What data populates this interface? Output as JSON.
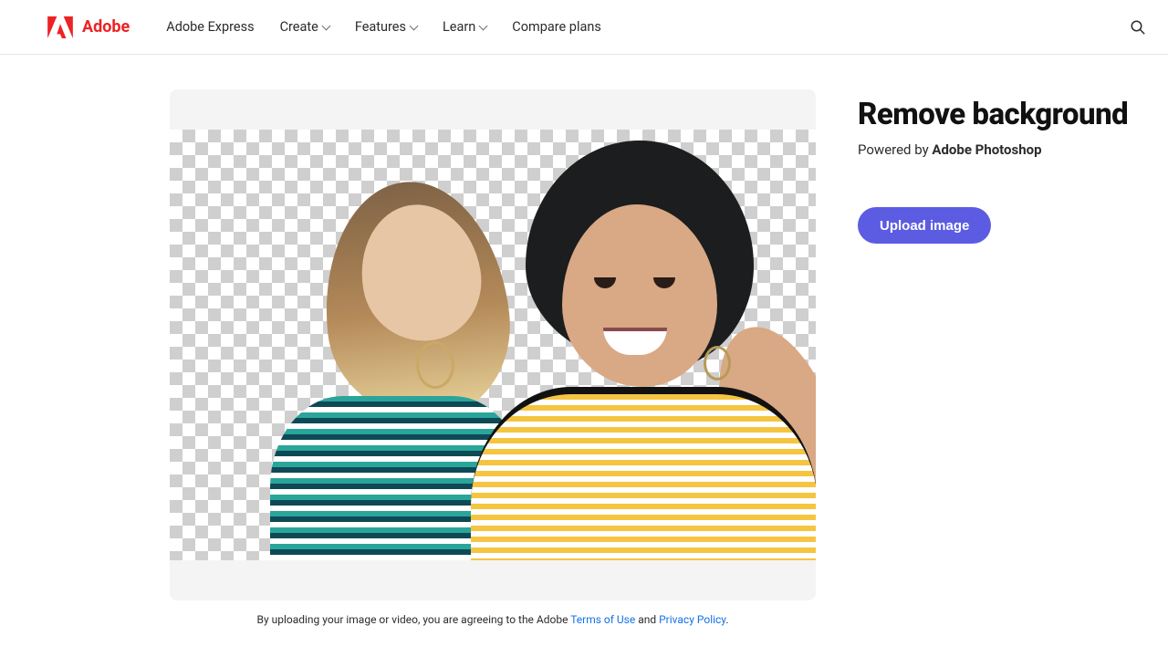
{
  "brand": {
    "name": "Adobe"
  },
  "nav": {
    "express": "Adobe Express",
    "create": "Create",
    "features": "Features",
    "learn": "Learn",
    "compare": "Compare plans"
  },
  "hero": {
    "title": "Remove background",
    "powered_by_prefix": "Powered by ",
    "powered_by_brand": "Adobe Photoshop",
    "upload_label": "Upload image"
  },
  "disclaimer": {
    "prefix": "By uploading your image or video, you are agreeing to the Adobe ",
    "terms": "Terms of Use",
    "and": " and ",
    "privacy": "Privacy Policy",
    "suffix": "."
  },
  "colors": {
    "brand_red": "#ED2224",
    "primary_button": "#5b5ce2",
    "link": "#1473e6"
  }
}
